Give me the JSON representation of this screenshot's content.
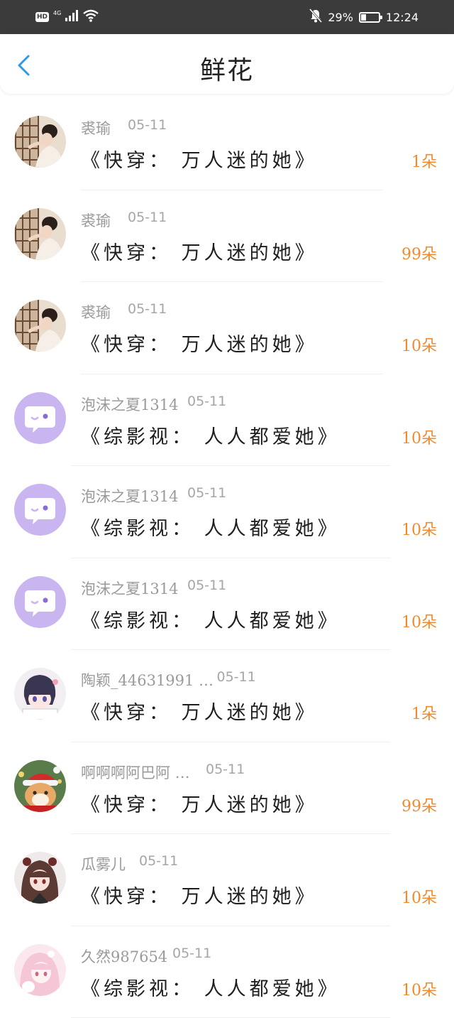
{
  "status_bar": {
    "hd": "HD",
    "network": "4G",
    "battery_percent": "29%",
    "battery_level": 0.29,
    "time": "12:24"
  },
  "nav": {
    "title": "鲜花"
  },
  "items": [
    {
      "name": "裘瑜",
      "date": "05-11",
      "book": "《快穿： 万人迷的她》",
      "count": "1朵",
      "avatar": "photo-woman-window"
    },
    {
      "name": "裘瑜",
      "date": "05-11",
      "book": "《快穿： 万人迷的她》",
      "count": "99朵",
      "avatar": "photo-woman-window"
    },
    {
      "name": "裘瑜",
      "date": "05-11",
      "book": "《快穿： 万人迷的她》",
      "count": "10朵",
      "avatar": "photo-woman-window"
    },
    {
      "name": "泡沫之夏1314",
      "date": "05-11",
      "book": "《综影视： 人人都爱她》",
      "count": "10朵",
      "avatar": "default-chat"
    },
    {
      "name": "泡沫之夏1314",
      "date": "05-11",
      "book": "《综影视： 人人都爱她》",
      "count": "10朵",
      "avatar": "default-chat"
    },
    {
      "name": "泡沫之夏1314",
      "date": "05-11",
      "book": "《综影视： 人人都爱她》",
      "count": "10朵",
      "avatar": "default-chat"
    },
    {
      "name": "陶颖_44631991 …",
      "date": "05-11",
      "book": "《快穿： 万人迷的她》",
      "count": "1朵",
      "avatar": "anime-boy"
    },
    {
      "name": "啊啊啊阿巴阿 …",
      "date": "05-11",
      "book": "《快穿： 万人迷的她》",
      "count": "99朵",
      "avatar": "christmas-cat"
    },
    {
      "name": "瓜雾儿",
      "date": "05-11",
      "book": "《快穿： 万人迷的她》",
      "count": "10朵",
      "avatar": "anime-girl-dark"
    },
    {
      "name": "久然987654",
      "date": "05-11",
      "book": "《综影视： 人人都爱她》",
      "count": "10朵",
      "avatar": "anime-girl-pink"
    }
  ],
  "colors": {
    "status_bg": "#3b3b3b",
    "accent_blue": "#2f9be6",
    "count_orange": "#f08a2c",
    "default_avatar": "#c9b6f0"
  }
}
